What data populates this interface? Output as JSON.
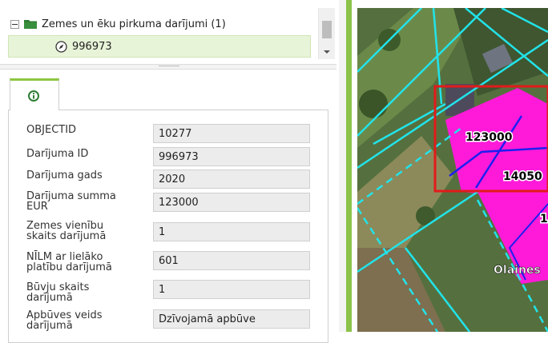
{
  "tree": {
    "parent_label": "Zemes un ēku pirkuma darījumi (1)",
    "child_label": "996973",
    "icons": {
      "collapse": "collapse-minus-icon",
      "folder": "folder-icon",
      "item": "compass-icon"
    }
  },
  "details": {
    "tab_icon": "info-icon",
    "fields": [
      {
        "label": "OBJECTID",
        "value": "10277"
      },
      {
        "label": "Darījuma ID",
        "value": "996973"
      },
      {
        "label": "Darījuma gads",
        "value": "2020"
      },
      {
        "label": "Darījuma summa EUR",
        "value": "123000"
      },
      {
        "label": "Zemes vienību skaits darījumā",
        "value": "1"
      },
      {
        "label": "NĪLM ar lielāko platību darījumā",
        "value": "601"
      },
      {
        "label": "Būvju skaits darījumā",
        "value": "1"
      },
      {
        "label": "Apbūves veids darījumā",
        "value": "Dzīvojamā apbūve"
      }
    ]
  },
  "map": {
    "labels": {
      "parcel_a": "123000",
      "parcel_b": "14050",
      "parcel_c": "1",
      "street": "Olaines"
    },
    "colors": {
      "parcel_fill": "#ff1ad9",
      "parcel_border": "#1e1ef0",
      "boundary_line": "#22e3ea",
      "selection": "#e11b1b",
      "accent_green": "#8bc34a"
    }
  }
}
